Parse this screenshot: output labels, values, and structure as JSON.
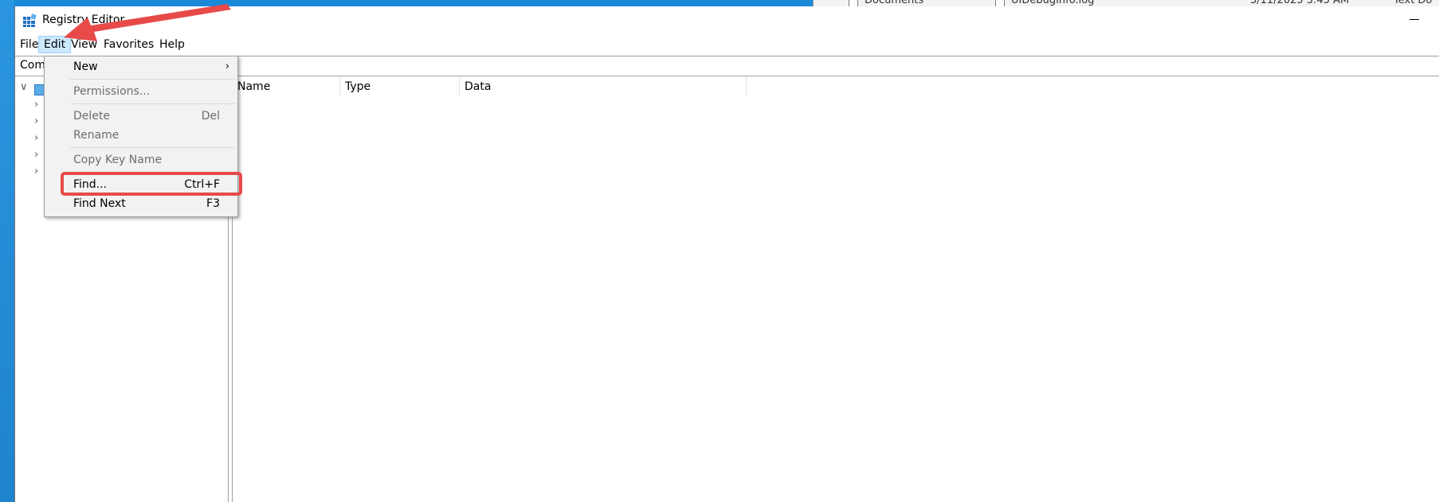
{
  "window": {
    "title": "Registry Editor"
  },
  "background_window": {
    "item1": "Documents",
    "item2": "UIDebugInfo.log",
    "date": "3/11/2025 3:45 AM",
    "type": "Text Do"
  },
  "menubar": {
    "items": [
      {
        "label": "File"
      },
      {
        "label": "Edit"
      },
      {
        "label": "View"
      },
      {
        "label": "Favorites"
      },
      {
        "label": "Help"
      }
    ]
  },
  "addressbar": {
    "text": "Com"
  },
  "list_headers": [
    {
      "label": "Name"
    },
    {
      "label": "Type"
    },
    {
      "label": "Data"
    }
  ],
  "edit_menu": {
    "items": [
      {
        "label": "New",
        "shortcut": "",
        "disabled": false,
        "submenu": true
      },
      {
        "label": "Permissions...",
        "shortcut": "",
        "disabled": true
      },
      {
        "label": "Delete",
        "shortcut": "Del",
        "disabled": true
      },
      {
        "label": "Rename",
        "shortcut": "",
        "disabled": true
      },
      {
        "label": "Copy Key Name",
        "shortcut": "",
        "disabled": true
      },
      {
        "label": "Find...",
        "shortcut": "Ctrl+F",
        "disabled": false
      },
      {
        "label": "Find Next",
        "shortcut": "F3",
        "disabled": false
      }
    ]
  },
  "colors": {
    "highlight": "#e84a4a",
    "menu_active_bg": "#cce8ff",
    "desktop": "#1a8ad8"
  }
}
